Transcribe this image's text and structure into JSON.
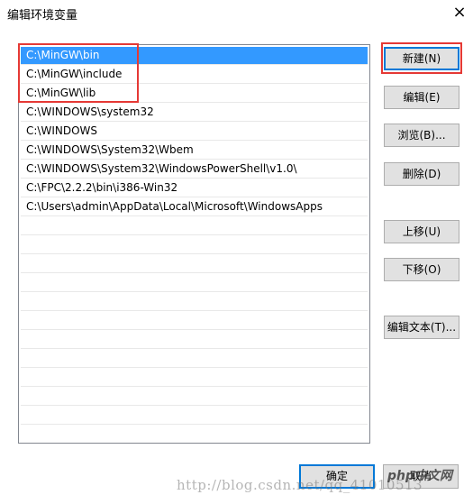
{
  "window": {
    "title": "编辑环境变量",
    "close_glyph": "×"
  },
  "list": {
    "items": [
      "C:\\MinGW\\bin",
      "C:\\MinGW\\include",
      "C:\\MinGW\\lib",
      "C:\\WINDOWS\\system32",
      "C:\\WINDOWS",
      "C:\\WINDOWS\\System32\\Wbem",
      "C:\\WINDOWS\\System32\\WindowsPowerShell\\v1.0\\",
      "C:\\FPC\\2.2.2\\bin\\i386-Win32",
      "C:\\Users\\admin\\AppData\\Local\\Microsoft\\WindowsApps",
      "",
      "",
      "",
      "",
      "",
      "",
      "",
      "",
      "",
      "",
      "",
      ""
    ],
    "selected_index": 0
  },
  "buttons": {
    "new": "新建(N)",
    "edit": "编辑(E)",
    "browse": "浏览(B)...",
    "delete": "删除(D)",
    "move_up": "上移(U)",
    "move_down": "下移(O)",
    "edit_text": "编辑文本(T)..."
  },
  "footer": {
    "ok": "确定",
    "cancel": "取消"
  },
  "watermark": {
    "text": "http://blog.csdn.net/qq_41010513",
    "logo": "php中文网"
  },
  "colors": {
    "selection": "#3399ff",
    "highlight_box": "#e53935",
    "button_face": "#e1e1e1",
    "focus_border": "#0078d7"
  }
}
